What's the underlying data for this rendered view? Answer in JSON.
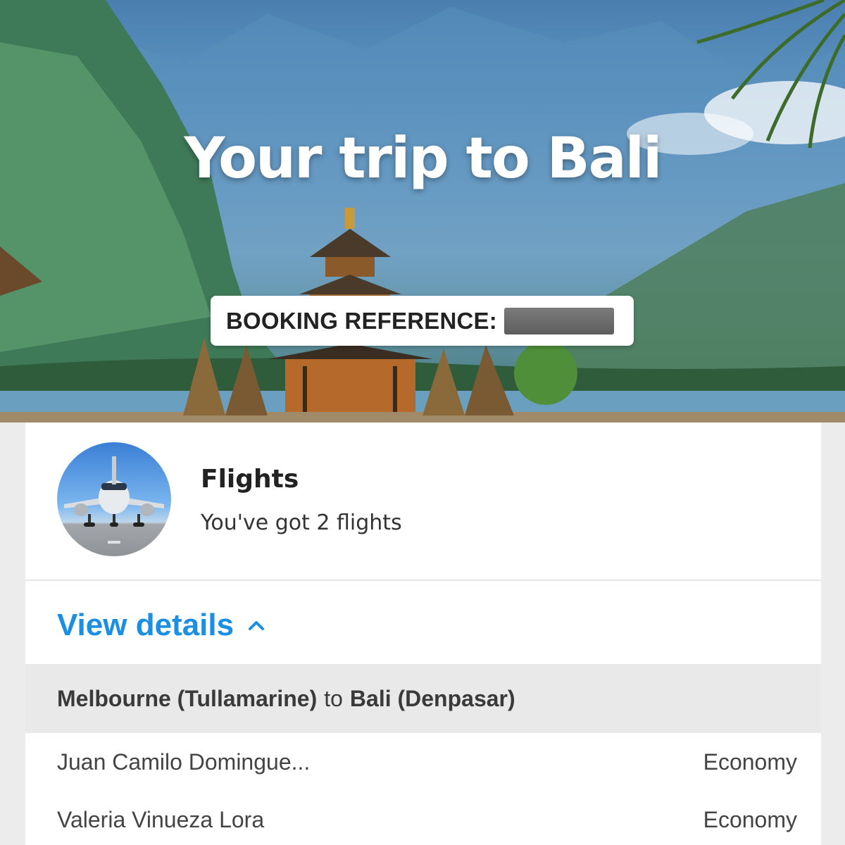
{
  "hero": {
    "title": "Your trip to Bali",
    "booking_label": "BOOKING REFERENCE:",
    "booking_value_redacted": true
  },
  "flights": {
    "title": "Flights",
    "subtitle": "You've got 2 flights",
    "avatar_icon": "airplane-icon",
    "view_details": "View details",
    "route": {
      "from": "Melbourne (Tullamarine)",
      "connector": "to",
      "to": "Bali (Denpasar)"
    },
    "passengers": [
      {
        "name": "Juan Camilo Domingue...",
        "class": "Economy"
      },
      {
        "name": "Valeria Vinueza Lora",
        "class": "Economy"
      }
    ]
  },
  "colors": {
    "accent": "#1b8fe3",
    "route_bg": "#e9e9e9",
    "card_bg": "#ffffff"
  }
}
